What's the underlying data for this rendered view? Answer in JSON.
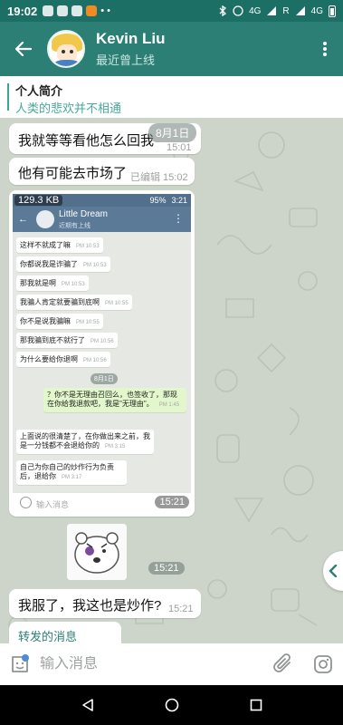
{
  "status_bar": {
    "time": "19:02",
    "signal_left": "4G",
    "signal_right": "4G",
    "roaming": "R"
  },
  "header": {
    "name": "Kevin Liu",
    "status": "最近曾上线"
  },
  "pinned": {
    "title": "个人简介",
    "subtitle": "人类的悲欢并不相通"
  },
  "messages": [
    {
      "text": "我就等等看他怎么回我",
      "time": "15:01"
    },
    {
      "text": "他有可能去市场了",
      "time": "已编辑 15:02"
    },
    {
      "text": "我服了，我这也是炒作?",
      "time": "15:21"
    }
  ],
  "date_chip": "8月1日",
  "screenshot": {
    "size": "129.3 KB",
    "battery": "95%",
    "clock": "3:21",
    "name": "Little Dream",
    "sub": "近期有上线",
    "input_placeholder": "输入消息",
    "time": "15:21",
    "date": "8月1日",
    "msgs": [
      {
        "text": "这样不就成了嘛",
        "time": "PM 10:53"
      },
      {
        "text": "你都说我是诈骗了",
        "time": "PM 10:53"
      },
      {
        "text": "那我就是啊",
        "time": "PM 10:53"
      },
      {
        "text": "我骗人肯定就要骗到底啊",
        "time": "PM 10:55"
      },
      {
        "text": "你不是说我骗嘛",
        "time": "PM 10:55"
      },
      {
        "text": "那我骗到底不就行了",
        "time": "PM 10:56"
      },
      {
        "text": "为什么要给你退啊",
        "time": "PM 10:56"
      }
    ],
    "green_msg": {
      "text": "？你不是无理由召回么，也签收了，那现在你给我退款吧，我是\"无理由\"。",
      "time": "PM 1:45"
    },
    "reply1": {
      "text": "上面说的很清楚了，在你做出来之前，我是一分钱都不会退给你的",
      "time": "PM 3:15"
    },
    "reply2": {
      "text": "自己为你自己的炒作行为负责后，退给你",
      "time": "PM 3:17"
    }
  },
  "sticker_time": "15:21",
  "forward": {
    "label": "转发的消息"
  },
  "input": {
    "placeholder": "输入消息"
  },
  "colors": {
    "header": "#2c7f75",
    "accent": "#49a99b",
    "status_bar": "#1c6f64"
  }
}
